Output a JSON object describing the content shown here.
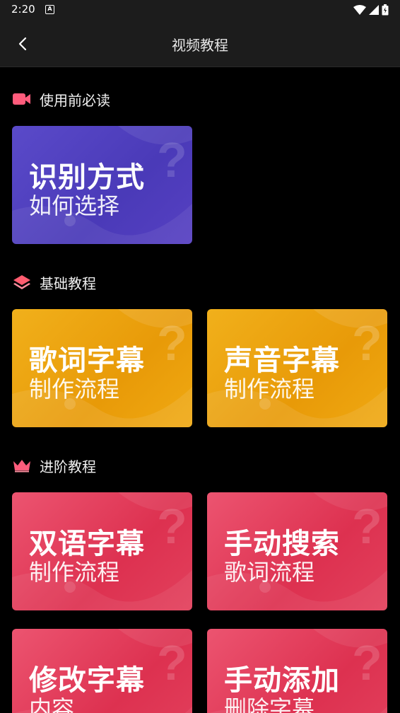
{
  "status_bar": {
    "time": "2:20",
    "notification_badge": "A"
  },
  "app_bar": {
    "title": "视频教程"
  },
  "sections": [
    {
      "title": "使用前必读",
      "icon": "video-camera-icon",
      "color": "#ff5c7c"
    },
    {
      "title": "基础教程",
      "icon": "layers-icon",
      "color": "#ff5c6f"
    },
    {
      "title": "进阶教程",
      "icon": "crown-icon",
      "color": "#ff5c7c"
    }
  ],
  "cards": [
    {
      "line1": "识别方式",
      "line2": "如何选择",
      "theme": "purple"
    },
    {
      "line1": "歌词字幕",
      "line2": "制作流程",
      "theme": "orange"
    },
    {
      "line1": "声音字幕",
      "line2": "制作流程",
      "theme": "orange"
    },
    {
      "line1": "双语字幕",
      "line2": "制作流程",
      "theme": "red"
    },
    {
      "line1": "手动搜索",
      "line2": "歌词流程",
      "theme": "red"
    },
    {
      "line1": "修改字幕",
      "line2": "内容",
      "theme": "red"
    },
    {
      "line1": "手动添加",
      "line2": "删除字幕",
      "theme": "red"
    }
  ]
}
